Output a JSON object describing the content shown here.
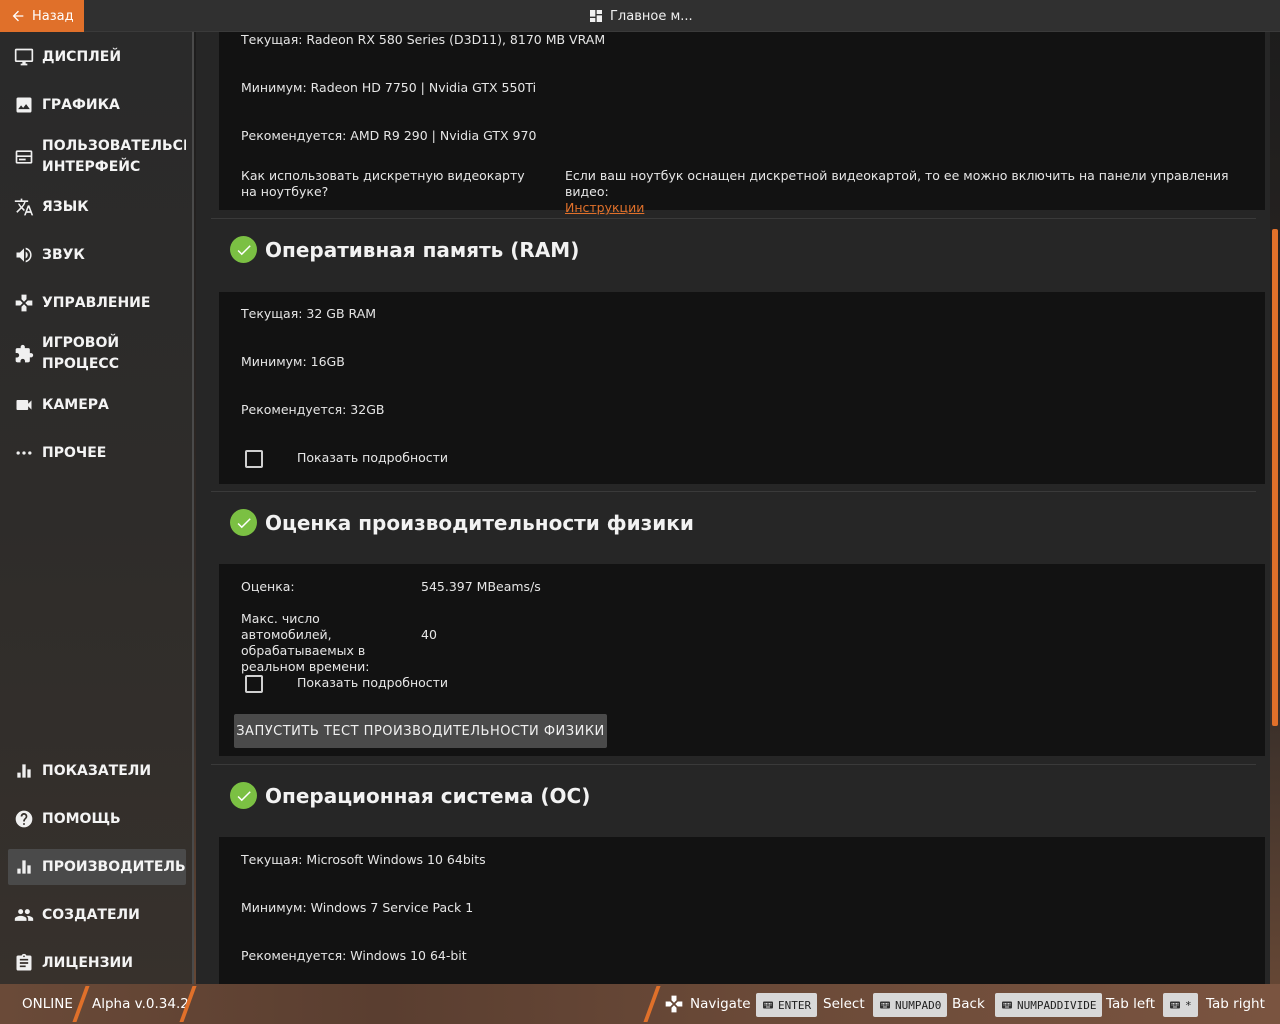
{
  "topbar": {
    "back_label": "Назад",
    "title": "Главное м..."
  },
  "sidebar": {
    "items": [
      {
        "label": "ДИСПЛЕЙ",
        "icon": "monitor-icon"
      },
      {
        "label": "ГРАФИКА",
        "icon": "image-icon"
      },
      {
        "label": "ПОЛЬЗОВАТЕЛЬСКИЙ ИНТЕРФЕЙС",
        "icon": "ui-icon"
      },
      {
        "label": "ЯЗЫК",
        "icon": "translate-icon"
      },
      {
        "label": "ЗВУК",
        "icon": "speaker-icon"
      },
      {
        "label": "УПРАВЛЕНИЕ",
        "icon": "gamepad-icon"
      },
      {
        "label": "ИГРОВОЙ ПРОЦЕСС",
        "icon": "puzzle-icon"
      },
      {
        "label": "КАМЕРА",
        "icon": "camera-icon"
      },
      {
        "label": "ПРОЧЕЕ",
        "icon": "more-icon"
      },
      {
        "label": "ПОКАЗАТЕЛИ",
        "icon": "bar-chart-icon"
      },
      {
        "label": "ПОМОЩЬ",
        "icon": "help-icon"
      },
      {
        "label": "ПРОИЗВОДИТЕЛЬНОСТЬ",
        "icon": "bar-chart-icon",
        "active": true
      },
      {
        "label": "СОЗДАТЕЛИ",
        "icon": "people-icon"
      },
      {
        "label": "ЛИЦЕНЗИИ",
        "icon": "clipboard-icon"
      }
    ]
  },
  "gpu": {
    "current": "Текущая: Radeon RX 580 Series (D3D11), 8170 MB VRAM",
    "minimum": "Минимум: Radeon HD 7750 | Nvidia GTX 550Ti",
    "recommended": "Рекомендуется: AMD R9 290 | Nvidia GTX 970",
    "laptop_question": "Как использовать дискретную видеокарту на ноутбуке?",
    "laptop_answer": "Если ваш ноутбук оснащен дискретной видеокартой, то ее можно включить на панели управления видео:",
    "laptop_link": "Инструкции"
  },
  "ram": {
    "heading": "Оперативная память (RAM)",
    "current": "Текущая: 32 GB RAM",
    "minimum": "Минимум: 16GB",
    "recommended": "Рекомендуется: 32GB",
    "details_label": "Показать подробности",
    "details_checked": false
  },
  "physics": {
    "heading": "Оценка производительности физики",
    "score_label": "Оценка:",
    "score_value": "545.397 MBeams/s",
    "cars_label": "Макс. число автомобилей, обрабатываемых в реальном времени:",
    "cars_value": "40",
    "details_label": "Показать подробности",
    "details_checked": false,
    "run_button": "ЗАПУСТИТЬ ТЕСТ ПРОИЗВОДИТЕЛЬНОСТИ ФИЗИКИ"
  },
  "os": {
    "heading": "Операционная система (ОС)",
    "current": "Текущая: Microsoft Windows 10 64bits",
    "minimum": "Минимум: Windows 7 Service Pack 1",
    "recommended": "Рекомендуется: Windows 10 64-bit"
  },
  "bottombar": {
    "status": "ONLINE",
    "version": "Alpha v.0.34.2",
    "hints": [
      {
        "key": "",
        "action": "Navigate"
      },
      {
        "key": "ENTER",
        "action": "Select"
      },
      {
        "key": "NUMPAD0",
        "action": "Back"
      },
      {
        "key": "NUMPADDIVIDE",
        "action": "Tab left"
      },
      {
        "key": "*",
        "action": "Tab right"
      }
    ]
  },
  "colors": {
    "accent": "#e0702a",
    "check": "#7bc043"
  }
}
